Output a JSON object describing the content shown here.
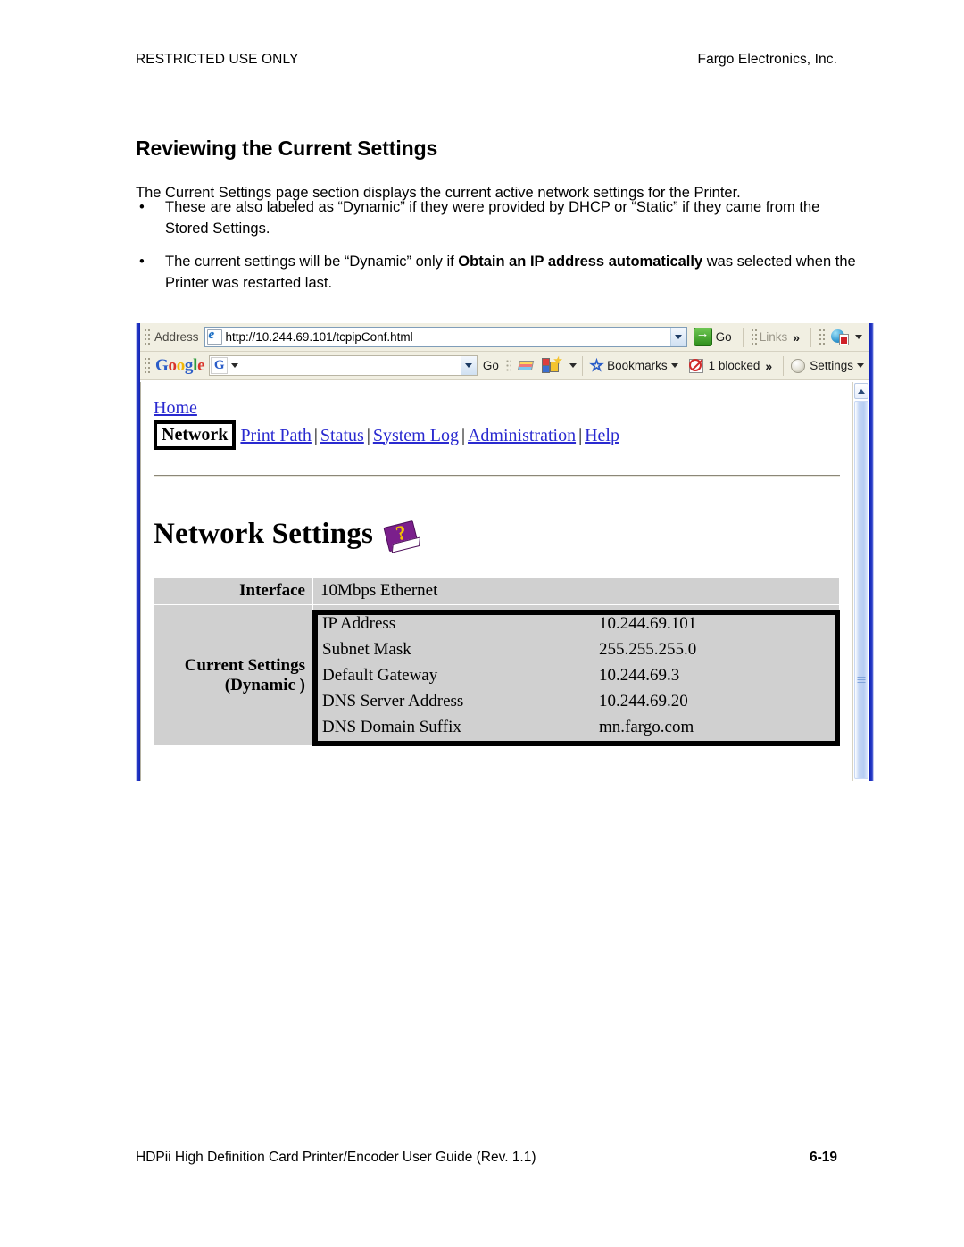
{
  "header": {
    "left": "RESTRICTED USE ONLY",
    "right": "Fargo Electronics, Inc."
  },
  "section_title": "Reviewing the Current Settings",
  "intro": "The Current Settings page section displays the current active network settings for the Printer.",
  "bullets": [
    {
      "marker": "•",
      "text_before": "These are also labeled as “Dynamic” if they were provided by DHCP or “Static” if they came from the Stored Settings.",
      "bold": "",
      "text_after": ""
    },
    {
      "marker": "•",
      "text_before": "The current settings will be “Dynamic” only if ",
      "bold": "Obtain an IP address automatically",
      "text_after": " was selected when the Printer was restarted last."
    }
  ],
  "browser": {
    "address_bar": {
      "label": "Address",
      "ie_icon": "internet-explorer-icon",
      "url": "http://10.244.69.101/tcpipConf.html",
      "dropdown_icon": "chevron-down-icon",
      "go_label": "Go",
      "go_icon": "green-arrow-go-icon",
      "links_label": "Links",
      "overflow_icon": "»",
      "globe_pdf_icon": "globe-pdf-icon",
      "globe_dropdown_icon": "chevron-down-icon"
    },
    "google_toolbar": {
      "logo_letters": [
        "G",
        "o",
        "o",
        "g",
        "l",
        "e"
      ],
      "logo_colors": [
        "#2a5cc8",
        "#d9342b",
        "#f2b705",
        "#2a5cc8",
        "#2f9c3d",
        "#d9342b"
      ],
      "search_badge": "G",
      "search_value": "",
      "search_placeholder": "",
      "dropdown_icon": "chevron-down-icon",
      "go_label": "Go",
      "highlighter_icon": "highlighter-icon",
      "autofill_icon": "autofill-blocks-icon",
      "autofill_dropdown_icon": "chevron-down-icon",
      "bookmarks_icon": "star-icon",
      "bookmarks_label": "Bookmarks",
      "blocked_icon": "popup-blocked-icon",
      "blocked_label": "1 blocked",
      "overflow_icon": "»",
      "settings_icon": "settings-ball-icon",
      "settings_label": "Settings"
    },
    "page": {
      "home_link": "Home",
      "active_tab": "Network",
      "nav_links": [
        "Print Path",
        "Status",
        "System Log",
        "Administration",
        "Help"
      ],
      "nav_separator": "|",
      "heading": "Network Settings",
      "heading_icon": "help-book-icon",
      "table": {
        "interface_label": "Interface",
        "interface_value": "10Mbps Ethernet",
        "current_label": "Current Settings",
        "current_sublabel": "(Dynamic )",
        "rows": [
          {
            "key": "IP Address",
            "value": "10.244.69.101"
          },
          {
            "key": "Subnet Mask",
            "value": "255.255.255.0"
          },
          {
            "key": "Default Gateway",
            "value": "10.244.69.3"
          },
          {
            "key": "DNS Server Address",
            "value": "10.244.69.20"
          },
          {
            "key": "DNS Domain Suffix",
            "value": "mn.fargo.com"
          }
        ]
      }
    },
    "scrollbar": {
      "up_arrow_icon": "chevron-up-icon"
    }
  },
  "footer": {
    "left": "HDPii High Definition Card Printer/Encoder User Guide (Rev. 1.1)",
    "right": "6-19"
  }
}
